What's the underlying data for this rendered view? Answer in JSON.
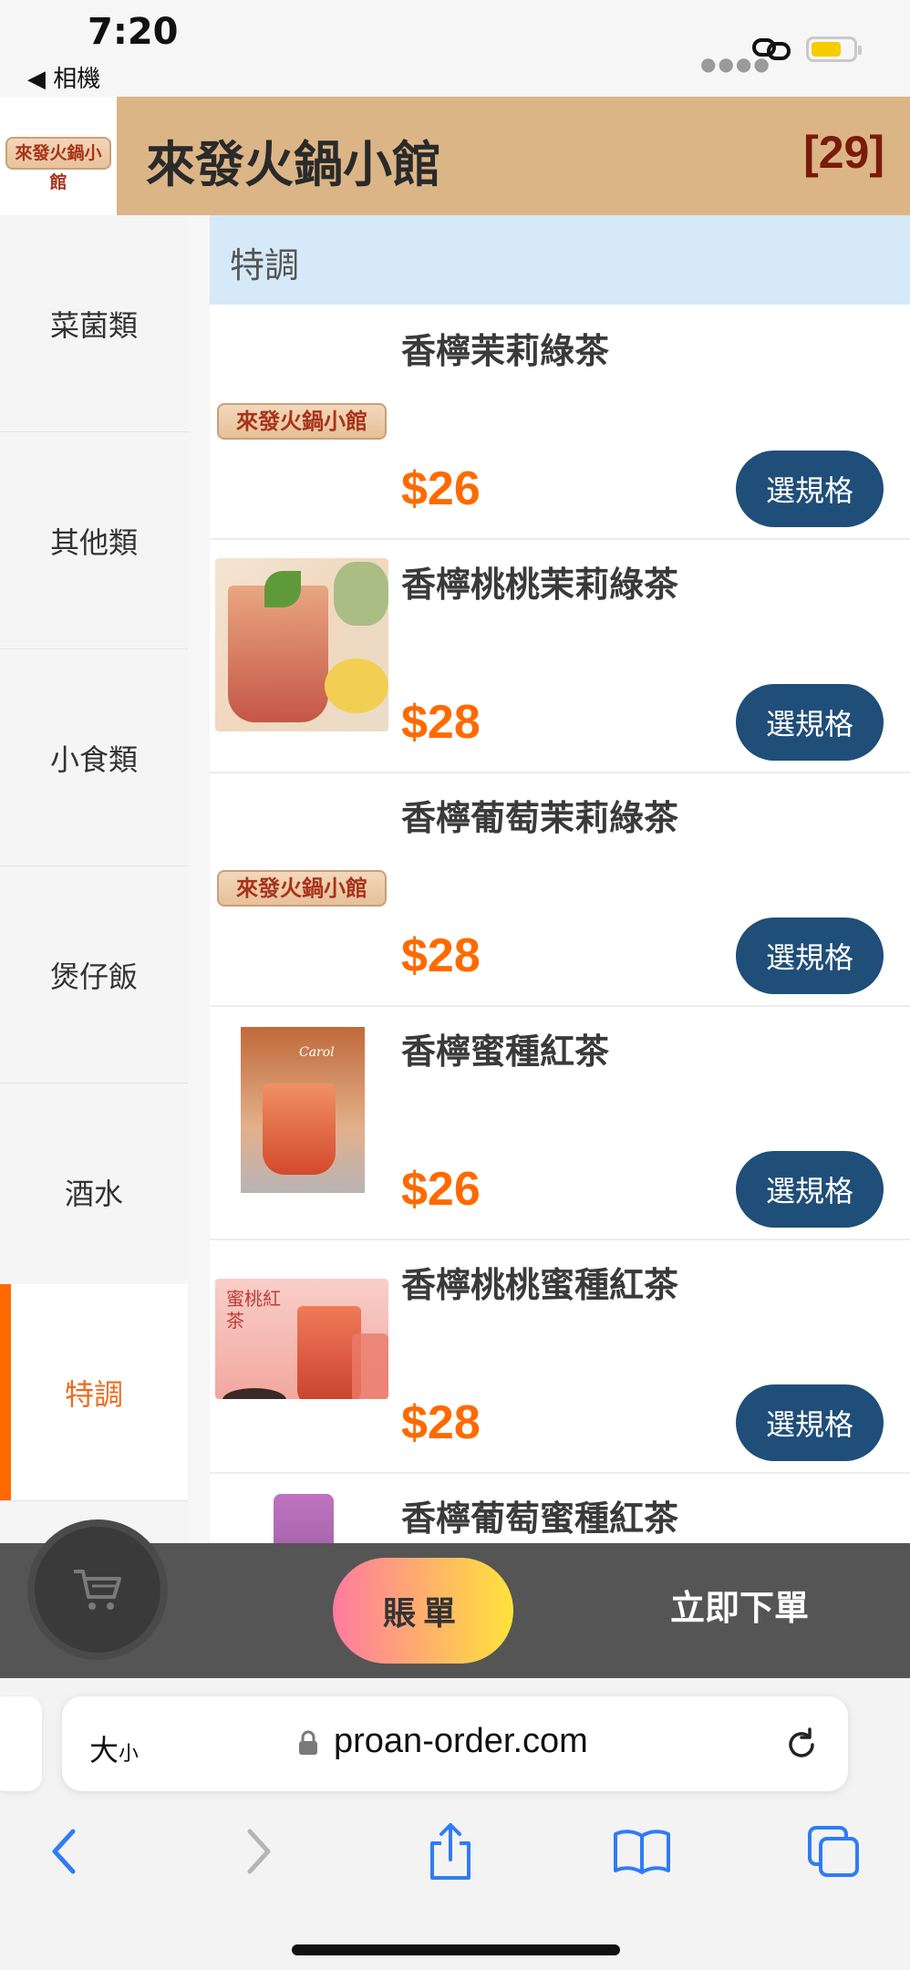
{
  "status": {
    "time": "7:20",
    "back_app": "◀ 相機"
  },
  "header": {
    "logo_text": "來發火鍋小館",
    "title": "來發火鍋小館",
    "table_number": "[29]"
  },
  "sidebar": {
    "items": [
      {
        "label": "菜菌類",
        "active": false
      },
      {
        "label": "其他類",
        "active": false
      },
      {
        "label": "小食類",
        "active": false
      },
      {
        "label": "煲仔飯",
        "active": false
      },
      {
        "label": "酒水",
        "active": false
      },
      {
        "label": "特調",
        "active": true
      }
    ]
  },
  "menu": {
    "section_title": "特調",
    "button_label": "選規格",
    "items": [
      {
        "name": "香檸茉莉綠茶",
        "price": "$26",
        "image": "logo-placeholder"
      },
      {
        "name": "香檸桃桃茉莉綠茶",
        "price": "$28",
        "image": "peach-iced-tea"
      },
      {
        "name": "香檸葡萄茉莉綠茶",
        "price": "$28",
        "image": "logo-placeholder"
      },
      {
        "name": "香檸蜜種紅茶",
        "price": "$26",
        "image": "carol-black-tea"
      },
      {
        "name": "香檸桃桃蜜種紅茶",
        "price": "$28",
        "image": "peach-black-tea"
      },
      {
        "name": "香檸葡萄蜜種紅茶",
        "price": "",
        "image": "grape-black-tea"
      }
    ],
    "thumb_texts": {
      "logo": "來發火鍋小館",
      "carol": "Carol",
      "peach_tea_label": "蜜桃紅茶"
    }
  },
  "bottom_bar": {
    "cart_icon": "cart-icon",
    "bill_label": "賬單",
    "order_label": "立即下單"
  },
  "browser": {
    "text_size_big": "大",
    "text_size_small": "小",
    "url": "proan-order.com"
  },
  "colors": {
    "header_bg": "#dcb587",
    "accent_orange": "#ff6a00",
    "button_blue": "#1f4e79",
    "section_bg": "#d6e9f8",
    "table_number": "#7a1a0a"
  }
}
